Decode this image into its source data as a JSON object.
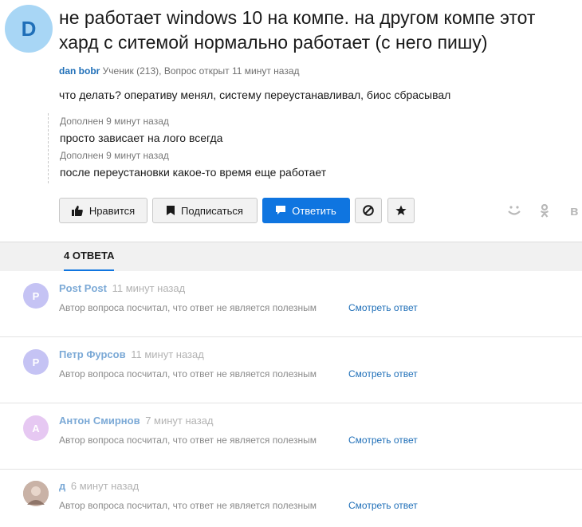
{
  "question": {
    "avatar_letter": "D",
    "title": "не работает windows 10 на компе. на другом компе этот хард с ситемой нормально работает (с него пишу)",
    "author": "dan bobr",
    "meta": "Ученик (213), Вопрос открыт 11 минут назад",
    "body": "что делать? оперативу менял, систему переустанавливал, биос сбрасывал",
    "addenda": [
      {
        "label": "Дополнен 9 минут назад",
        "text": "просто зависает на лого всегда"
      },
      {
        "label": "Дополнен 9 минут назад",
        "text": "после переустановки какое-то время еще работает"
      }
    ]
  },
  "actions": {
    "like_label": "Нравится",
    "subscribe_label": "Подписаться",
    "answer_label": "Ответить"
  },
  "share": {
    "mm": "ᵕ̈",
    "ok": "ꘘ",
    "vk": "в"
  },
  "tabs": {
    "answers_label": "4 ОТВЕТА"
  },
  "answers": [
    {
      "avatar_letter": "P",
      "avatar_color": "#c5c3f4",
      "name": "Post Post",
      "time": "11 минут назад",
      "note": "Автор вопроса посчитал, что ответ не является полезным",
      "link": "Смотреть ответ"
    },
    {
      "avatar_letter": "P",
      "avatar_color": "#c5c3f4",
      "name": "Петр Фурсов",
      "time": "11 минут назад",
      "note": "Автор вопроса посчитал, что ответ не является полезным",
      "link": "Смотреть ответ"
    },
    {
      "avatar_letter": "A",
      "avatar_color": "#e6c8f2",
      "name": "Антон Смирнов",
      "time": "7 минут назад",
      "note": "Автор вопроса посчитал, что ответ не является полезным",
      "link": "Смотреть ответ"
    },
    {
      "avatar_letter": "",
      "avatar_color": "#b9a39a",
      "name": "д",
      "time": "6 минут назад",
      "note": "Автор вопроса посчитал, что ответ не является полезным",
      "link": "Смотреть ответ"
    }
  ]
}
